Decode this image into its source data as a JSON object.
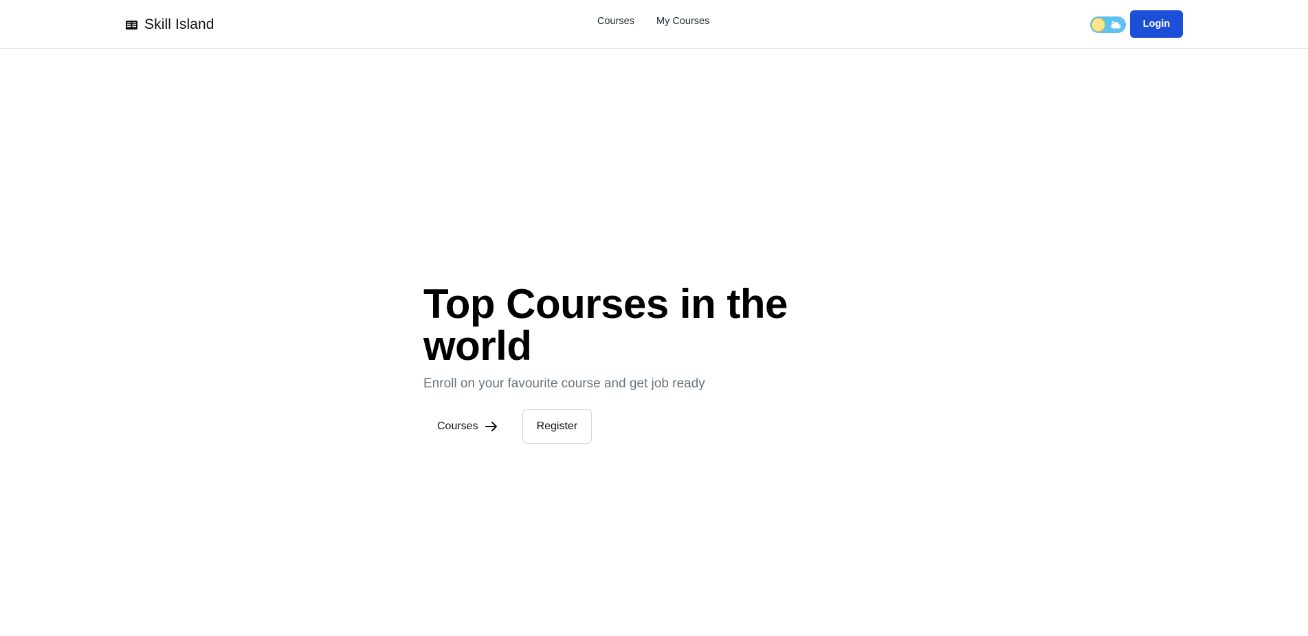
{
  "header": {
    "brand": "Skill Island",
    "brand_icon": "open-book-icon",
    "nav": [
      {
        "label": "Courses"
      },
      {
        "label": "My Courses"
      }
    ],
    "theme_toggle": {
      "state": "light",
      "knob_icon": "sun-icon",
      "cloud_icon": "cloud-icon",
      "track_color": "#5cc2f2",
      "knob_color": "#fde68a"
    },
    "login_label": "Login",
    "login_color": "#1d4ed8"
  },
  "hero": {
    "title": "Top Courses in the world",
    "subtitle": "Enroll on your favourite course and get job ready",
    "primary_label": "Courses",
    "primary_icon": "arrow-right-icon",
    "secondary_label": "Register"
  }
}
